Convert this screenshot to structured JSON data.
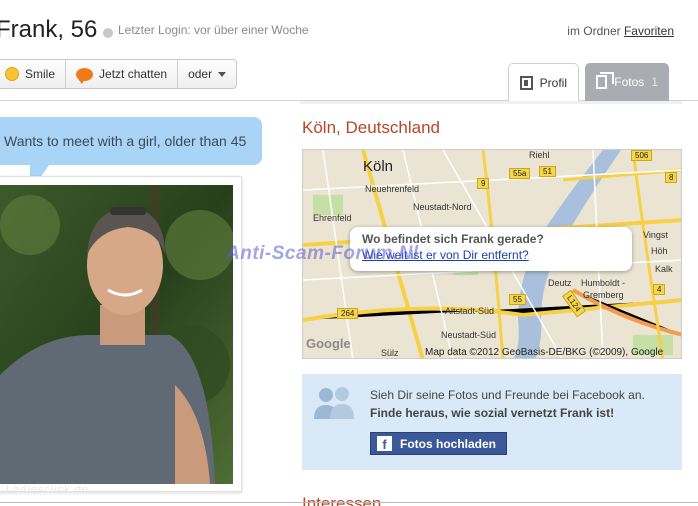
{
  "header": {
    "name_age": "Frank, 56",
    "last_login": "Letzter Login: vor über einer Woche",
    "folder_prefix": "im Ordner",
    "folder_link": "Favoriten"
  },
  "actions": {
    "smile": "Smile",
    "chat": "Jetzt chatten",
    "more": "oder"
  },
  "tabs": {
    "profil": "Profil",
    "fotos": "Fotos",
    "fotos_count": "1"
  },
  "about": {
    "tagline": "Wants to meet with a girl, older than 45"
  },
  "photo": {
    "watermark": "Ladiesclick.de"
  },
  "location": {
    "title": "Köln, Deutschland",
    "popup_question": "Wo befindet sich Frank gerade?",
    "popup_link": "Wie weit ist er von Dir entfernt?",
    "map_credit": "Map data ©2012 GeoBasis-DE/BKG (©2009), Google",
    "google_logo": "Google",
    "labels": {
      "koln": "Köln",
      "neuehrenfeld": "Neuehrenfeld",
      "neustadt_nord": "Neustadt-Nord",
      "ehrenfeld": "Ehrenfeld",
      "riehl": "Riehl",
      "kalk": "Kalk",
      "deutz": "Deutz",
      "humboldt": "Humboldt -",
      "gremberg": "Gremberg",
      "altstadt_sud": "Altstadt-Süd",
      "neustadt_sud": "Neustadt-Süd",
      "sulz": "Sülz",
      "vingst": "Vingst",
      "hoh": "Höh"
    },
    "shields": [
      "506",
      "55a",
      "51",
      "9",
      "8",
      "9",
      "264",
      "55",
      "4",
      "L124"
    ]
  },
  "facebook": {
    "line1": "Sieh Dir seine Fotos und Freunde bei Facebook an.",
    "line2": "Finde heraus, wie sozial vernetzt Frank ist!",
    "button": "Fotos hochladen"
  },
  "sections": {
    "interessen": "Interessen"
  },
  "overlay": {
    "watermark": "Anti-Scam-Forum.Nl"
  },
  "colors": {
    "accent_red": "#b8452a",
    "bubble_blue": "#a9d4f5",
    "facebook_blue": "#3b5998",
    "fb_box_bg": "#d9e9f8"
  }
}
